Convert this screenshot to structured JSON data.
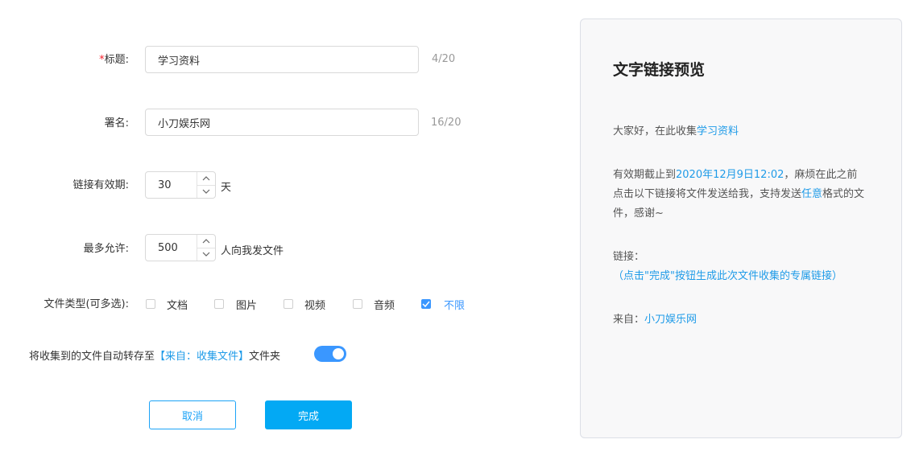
{
  "form": {
    "title": {
      "required_mark": "*",
      "label": "标题:",
      "value": "学习资料",
      "counter": "4/20"
    },
    "signature": {
      "label": "署名:",
      "value": "小刀娱乐网",
      "counter": "16/20"
    },
    "validity": {
      "label": "链接有效期:",
      "value": "30",
      "unit": "天"
    },
    "max_allow": {
      "label": "最多允许:",
      "value": "500",
      "unit": "人向我发文件"
    },
    "file_types": {
      "label": "文件类型(可多选):",
      "options": [
        {
          "label": "文档",
          "checked": false
        },
        {
          "label": "图片",
          "checked": false
        },
        {
          "label": "视频",
          "checked": false
        },
        {
          "label": "音频",
          "checked": false
        },
        {
          "label": "不限",
          "checked": true
        }
      ]
    },
    "auto_save": {
      "prefix": "将收集到的文件自动转存至",
      "folder": "【来自：收集文件】",
      "suffix": "文件夹",
      "enabled": true
    },
    "buttons": {
      "cancel": "取消",
      "done": "完成"
    }
  },
  "preview": {
    "title": "文字链接预览",
    "greeting": "大家好，在此收集",
    "greeting_topic": "学习资料",
    "validity_prefix": "有效期截止到",
    "validity_date": "2020年12月9日12:02",
    "validity_mid": "，麻烦在此之前点击以下链接将文件发送给我，支持发送",
    "validity_any": "任意",
    "validity_suffix": "格式的文件，感谢~",
    "link_label": "链接：",
    "link_value": "（点击\"完成\"按钮生成此次文件收集的专属链接）",
    "from_label": "来自：",
    "from_value": "小刀娱乐网"
  },
  "colors": {
    "accent": "#1f9be8",
    "button": "#03a9f4",
    "toggle": "#3a97ff",
    "required": "#f5222d"
  }
}
